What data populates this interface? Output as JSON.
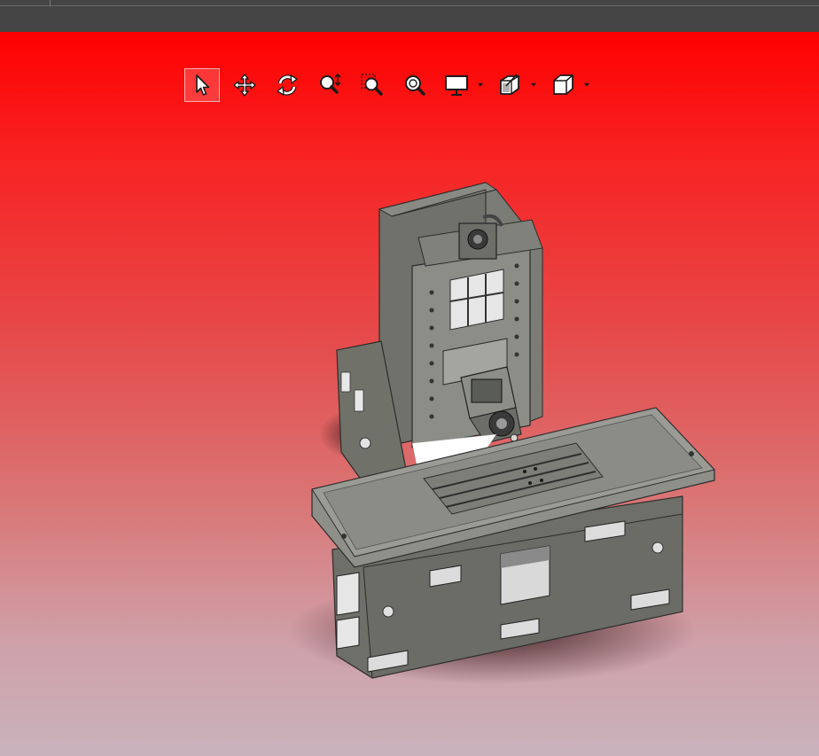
{
  "toolbar": {
    "items": [
      {
        "name": "select",
        "icon": "select-arrow-icon",
        "active": true
      },
      {
        "name": "pan",
        "icon": "pan-move-icon"
      },
      {
        "name": "rotate",
        "icon": "rotate-icon"
      },
      {
        "name": "zoom",
        "icon": "zoom-icon"
      },
      {
        "name": "zoom-window",
        "icon": "zoom-window-icon"
      },
      {
        "name": "zoom-fit",
        "icon": "zoom-fit-icon"
      },
      {
        "name": "display-mode",
        "icon": "monitor-icon",
        "dropdown": true
      },
      {
        "name": "section-view",
        "icon": "section-cube-icon",
        "dropdown": true
      },
      {
        "name": "standard-views",
        "icon": "view-cube-icon",
        "dropdown": true
      }
    ]
  },
  "viewport": {
    "background_top": "#ff0000",
    "background_bottom": "#c9b2bc",
    "model": "cnc-milling-machine-assembly",
    "model_color": "#7d8077"
  }
}
